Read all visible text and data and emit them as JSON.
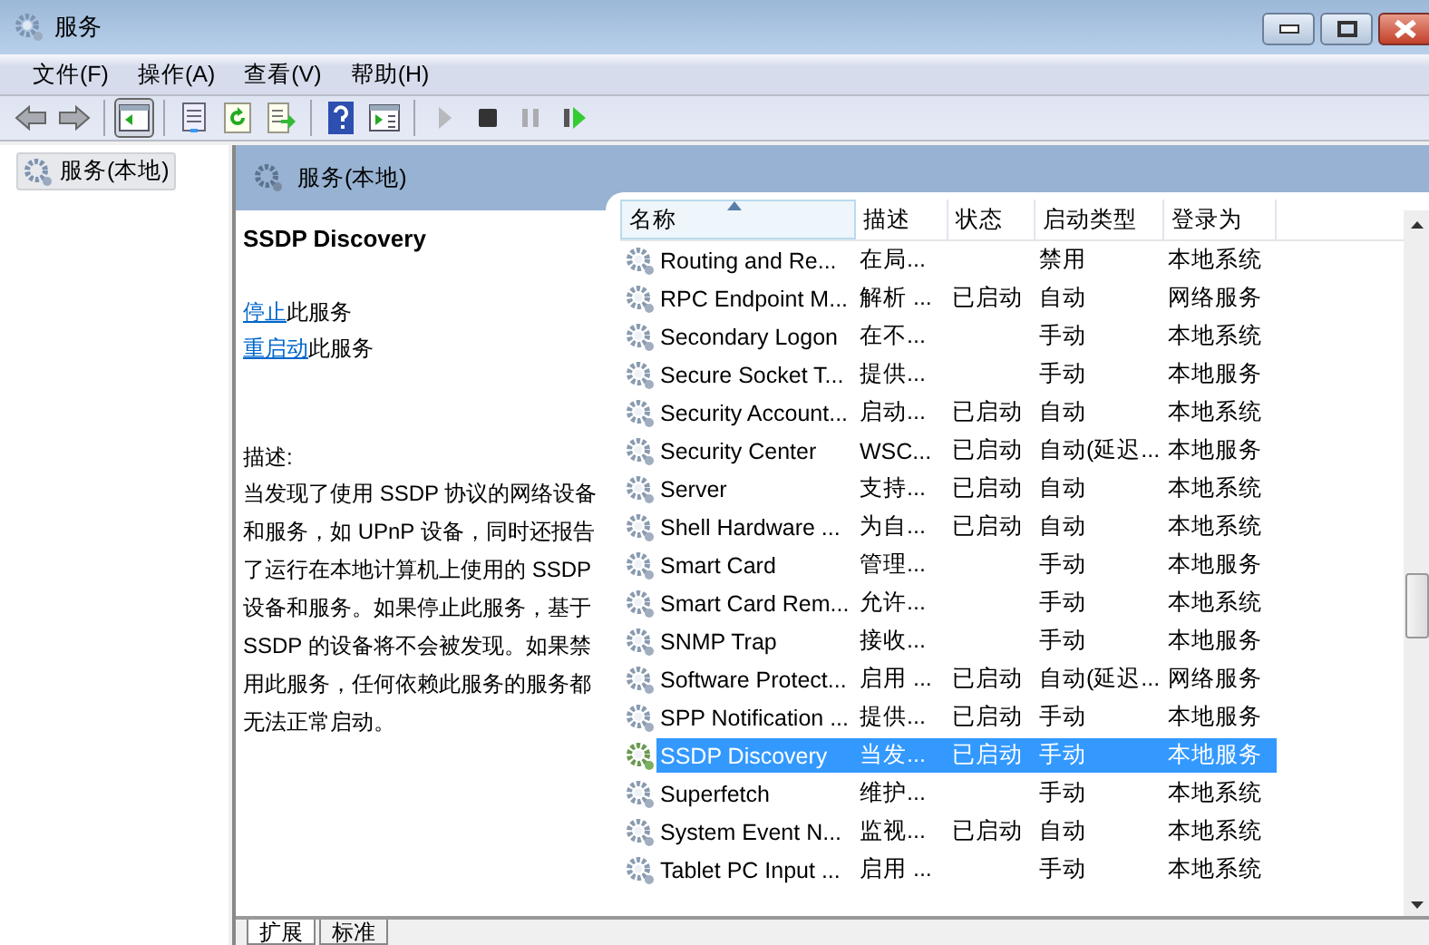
{
  "window": {
    "title": "服务"
  },
  "menu": [
    "文件(F)",
    "操作(A)",
    "查看(V)",
    "帮助(H)"
  ],
  "toolbar": [
    {
      "kind": "back",
      "disabled": false
    },
    {
      "kind": "forward",
      "disabled": false
    },
    {
      "kind": "sep"
    },
    {
      "kind": "console",
      "pressed": true
    },
    {
      "kind": "sep"
    },
    {
      "kind": "properties",
      "disabled": false
    },
    {
      "kind": "refresh",
      "disabled": false
    },
    {
      "kind": "export",
      "disabled": false
    },
    {
      "kind": "sep"
    },
    {
      "kind": "help",
      "disabled": false
    },
    {
      "kind": "view",
      "disabled": false
    },
    {
      "kind": "sep"
    },
    {
      "kind": "start",
      "disabled": true
    },
    {
      "kind": "stop",
      "disabled": false
    },
    {
      "kind": "pause",
      "disabled": true
    },
    {
      "kind": "restart",
      "disabled": false
    }
  ],
  "tree": {
    "items": [
      {
        "label": "服务(本地)",
        "selected": true
      }
    ]
  },
  "panel": {
    "title": "服务(本地)"
  },
  "details": {
    "title": "SSDP Discovery",
    "actions": [
      {
        "link": "停止",
        "text": "此服务"
      },
      {
        "link": "重启动",
        "text": "此服务"
      }
    ],
    "description_label": "描述:",
    "description": "当发现了使用 SSDP 协议的网络设备和服务，如 UPnP 设备，同时还报告了运行在本地计算机上使用的 SSDP 设备和服务。如果停止此服务，基于 SSDP 的设备将不会被发现。如果禁用此服务，任何依赖此服务的服务都无法正常启动。"
  },
  "table": {
    "columns": [
      {
        "label": "名称",
        "sorted": true
      },
      {
        "label": "描述",
        "sorted": false
      },
      {
        "label": "状态",
        "sorted": false
      },
      {
        "label": "启动类型",
        "sorted": false
      },
      {
        "label": "登录为",
        "sorted": false
      }
    ],
    "rows": [
      {
        "name": "Routing and Re...",
        "description": "在局...",
        "status": "",
        "startup": "禁用",
        "logon": "本地系统",
        "selected": false
      },
      {
        "name": "RPC Endpoint M...",
        "description": "解析 ...",
        "status": "已启动",
        "startup": "自动",
        "logon": "网络服务",
        "selected": false
      },
      {
        "name": "Secondary Logon",
        "description": "在不...",
        "status": "",
        "startup": "手动",
        "logon": "本地系统",
        "selected": false
      },
      {
        "name": "Secure Socket T...",
        "description": "提供...",
        "status": "",
        "startup": "手动",
        "logon": "本地服务",
        "selected": false
      },
      {
        "name": "Security Account...",
        "description": "启动...",
        "status": "已启动",
        "startup": "自动",
        "logon": "本地系统",
        "selected": false
      },
      {
        "name": "Security Center",
        "description": "WSC...",
        "status": "已启动",
        "startup": "自动(延迟...",
        "logon": "本地服务",
        "selected": false
      },
      {
        "name": "Server",
        "description": "支持...",
        "status": "已启动",
        "startup": "自动",
        "logon": "本地系统",
        "selected": false
      },
      {
        "name": "Shell Hardware ...",
        "description": "为自...",
        "status": "已启动",
        "startup": "自动",
        "logon": "本地系统",
        "selected": false
      },
      {
        "name": "Smart Card",
        "description": "管理...",
        "status": "",
        "startup": "手动",
        "logon": "本地服务",
        "selected": false
      },
      {
        "name": "Smart Card Rem...",
        "description": "允许...",
        "status": "",
        "startup": "手动",
        "logon": "本地系统",
        "selected": false
      },
      {
        "name": "SNMP Trap",
        "description": "接收...",
        "status": "",
        "startup": "手动",
        "logon": "本地服务",
        "selected": false
      },
      {
        "name": "Software Protect...",
        "description": "启用 ...",
        "status": "已启动",
        "startup": "自动(延迟...",
        "logon": "网络服务",
        "selected": false
      },
      {
        "name": "SPP Notification ...",
        "description": "提供...",
        "status": "已启动",
        "startup": "手动",
        "logon": "本地服务",
        "selected": false
      },
      {
        "name": "SSDP Discovery",
        "description": "当发...",
        "status": "已启动",
        "startup": "手动",
        "logon": "本地服务",
        "selected": true
      },
      {
        "name": "Superfetch",
        "description": "维护...",
        "status": "",
        "startup": "手动",
        "logon": "本地系统",
        "selected": false
      },
      {
        "name": "System Event N...",
        "description": "监视...",
        "status": "已启动",
        "startup": "自动",
        "logon": "本地系统",
        "selected": false
      },
      {
        "name": "Tablet PC Input ...",
        "description": "启用 ...",
        "status": "",
        "startup": "手动",
        "logon": "本地系统",
        "selected": false
      }
    ]
  },
  "bottom_tabs": [
    {
      "label": "扩展",
      "selected": true
    },
    {
      "label": "标准",
      "selected": false
    }
  ]
}
